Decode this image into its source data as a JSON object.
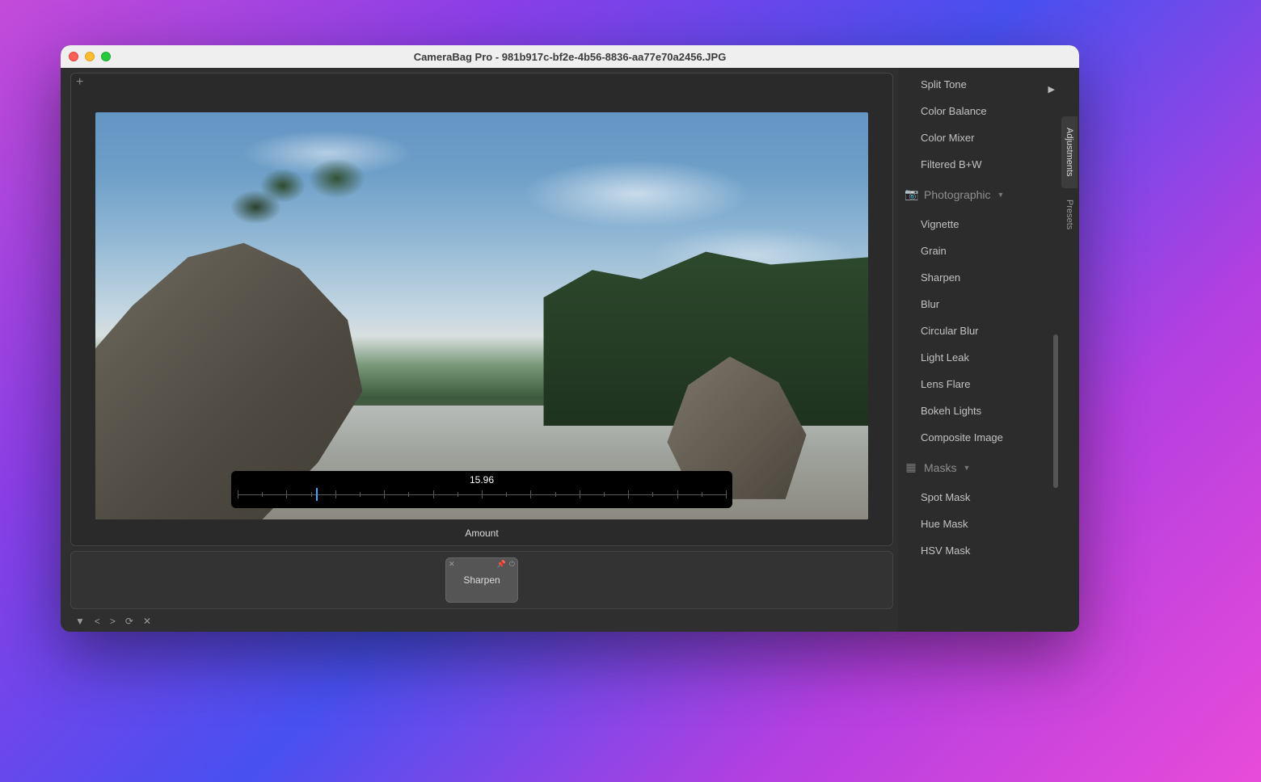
{
  "window": {
    "title": "CameraBag Pro - 981b917c-bf2e-4b56-8836-aa77e70a2456.JPG"
  },
  "slider": {
    "value": "15.96",
    "label": "Amount",
    "position_pct": 16
  },
  "tile": {
    "name": "Sharpen"
  },
  "sidebar": {
    "pre_items": [
      "Split Tone",
      "Color Balance",
      "Color Mixer",
      "Filtered B+W"
    ],
    "groups": [
      {
        "name": "Photographic",
        "icon": "camera",
        "items": [
          "Vignette",
          "Grain",
          "Sharpen",
          "Blur",
          "Circular Blur",
          "Light Leak",
          "Lens Flare",
          "Bokeh Lights",
          "Composite Image"
        ]
      },
      {
        "name": "Masks",
        "icon": "checker",
        "items": [
          "Spot Mask",
          "Hue Mask",
          "HSV Mask"
        ]
      }
    ]
  },
  "tabs": {
    "adjustments": "Adjustments",
    "presets": "Presets"
  }
}
